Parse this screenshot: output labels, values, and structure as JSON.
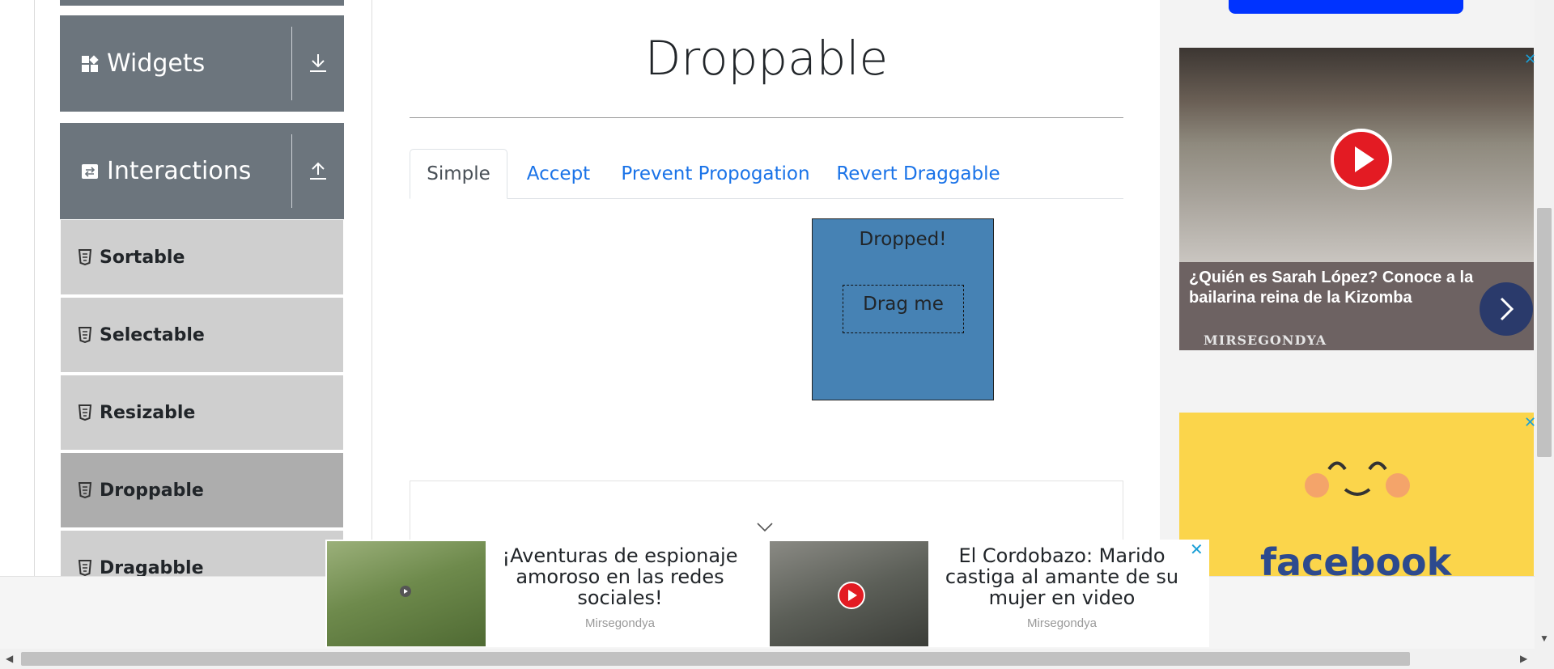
{
  "sidebar": {
    "groups": [
      {
        "label": "Widgets",
        "icon": "widgets-grid-icon",
        "toggle_icon": "download-arrow-icon"
      },
      {
        "label": "Interactions",
        "icon": "interactions-swap-icon",
        "toggle_icon": "upload-arrow-icon"
      }
    ],
    "items": [
      {
        "label": "Sortable",
        "active": false
      },
      {
        "label": "Selectable",
        "active": false
      },
      {
        "label": "Resizable",
        "active": false
      },
      {
        "label": "Droppable",
        "active": true
      },
      {
        "label": "Dragabble",
        "active": false
      }
    ],
    "item_icon": "html5-shield-icon",
    "colors": {
      "group_bg": "#6c757d",
      "item_bg": "#cfcfcf",
      "item_active_bg": "#adadad"
    }
  },
  "main": {
    "title": "Droppable",
    "tabs": [
      {
        "label": "Simple",
        "active": true
      },
      {
        "label": "Accept",
        "active": false
      },
      {
        "label": "Prevent Propogation",
        "active": false
      },
      {
        "label": "Revert Draggable",
        "active": false
      }
    ],
    "droppable": {
      "text": "Dropped!",
      "color": "#4682b4"
    },
    "draggable": {
      "text": "Drag me"
    },
    "tab_link_color": "#1a73e8"
  },
  "ads": {
    "right_top": {
      "headline": "¿Quién es Sarah López? Conoce a la bailarina reina de la Kizomba",
      "source": "MIRSEGONDYA",
      "close": "✕"
    },
    "right_bottom": {
      "brand": "facebook",
      "close": "✕"
    },
    "bottom": {
      "items": [
        {
          "title": "¡Aventuras de espionaje amoroso en las redes sociales!",
          "source": "Mirsegondya"
        },
        {
          "title": "El Cordobazo: Marido castiga al amante de su mujer en video",
          "source": "Mirsegondya"
        }
      ],
      "close": "✕"
    }
  },
  "scrollbars": {
    "left_arrow": "◀",
    "right_arrow": "▶",
    "down_arrow": "▼"
  }
}
